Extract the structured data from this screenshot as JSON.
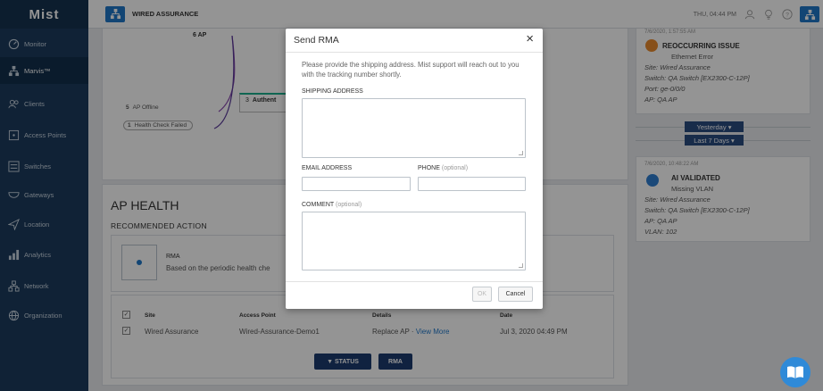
{
  "app": {
    "logo": "Mist"
  },
  "sidebar": {
    "items": [
      {
        "label": "Monitor",
        "icon": "monitor-icon"
      },
      {
        "label": "Marvis™",
        "icon": "marvis-icon"
      },
      {
        "label": "Clients",
        "icon": "clients-icon"
      },
      {
        "label": "Access Points",
        "icon": "access-point-icon"
      },
      {
        "label": "Switches",
        "icon": "switch-icon"
      },
      {
        "label": "Gateways",
        "icon": "gateway-icon"
      },
      {
        "label": "Location",
        "icon": "location-icon"
      },
      {
        "label": "Analytics",
        "icon": "analytics-icon"
      },
      {
        "label": "Network",
        "icon": "network-icon"
      },
      {
        "label": "Organization",
        "icon": "organization-icon"
      }
    ]
  },
  "header": {
    "title": "WIRED ASSURANCE",
    "time": "THU, 04:44 PM"
  },
  "flow": {
    "ap_label": "6 AP",
    "offline_count": "5",
    "offline_label": "AP Offline",
    "health_count": "1",
    "health_label": "Health Check Failed",
    "auth_count": "3",
    "auth_label": "Authent"
  },
  "ap_health": {
    "title": "AP HEALTH",
    "recommended": "RECOMMENDED ACTION",
    "card_title": "RMA",
    "card_desc": "Based on the periodic health che",
    "columns": [
      "Site",
      "Access Point",
      "Details",
      "Date"
    ],
    "row": {
      "site": "Wired Assurance",
      "ap": "Wired-Assurance-Demo1",
      "details": "Replace AP",
      "link": "View More",
      "date": "Jul 3, 2020 04:49 PM"
    },
    "status_btn": "▼ STATUS",
    "rma_btn": "RMA"
  },
  "right_panel": {
    "top_date": "7/6/2020, 1:57:55 AM",
    "issue1": {
      "title": "REOCCURRING ISSUE",
      "sub": "Ethernet Error",
      "site": "Site: Wired Assurance",
      "switch": "Switch: QA Switch [EX2300-C-12P]",
      "port": "Port: ge-0/0/0",
      "ap": "AP: QA AP"
    },
    "chip_yesterday": "Yesterday",
    "chip_last7": "Last 7 Days",
    "date2": "7/6/2020, 10:48:22 AM",
    "issue2": {
      "title": "AI VALIDATED",
      "sub": "Missing VLAN",
      "site": "Site: Wired Assurance",
      "switch": "Switch: QA Switch [EX2300-C-12P]",
      "ap": "AP: QA AP",
      "vlan": "VLAN: 102"
    }
  },
  "modal": {
    "title": "Send RMA",
    "close": "×",
    "description": "Please provide the shipping address. Mist support will reach out to you with the tracking number shortly.",
    "shipping_label": "SHIPPING ADDRESS",
    "email_label": "EMAIL ADDRESS",
    "phone_label": "PHONE",
    "phone_optional": "(optional)",
    "comment_label": "COMMENT",
    "comment_optional": "(optional)",
    "ok": "OK",
    "cancel": "Cancel"
  },
  "colors": {
    "sidebar": "#1c3c5e",
    "accent": "#1f77c9",
    "button_dark": "#1c3c6e",
    "issue_orange": "#e88a2e"
  }
}
